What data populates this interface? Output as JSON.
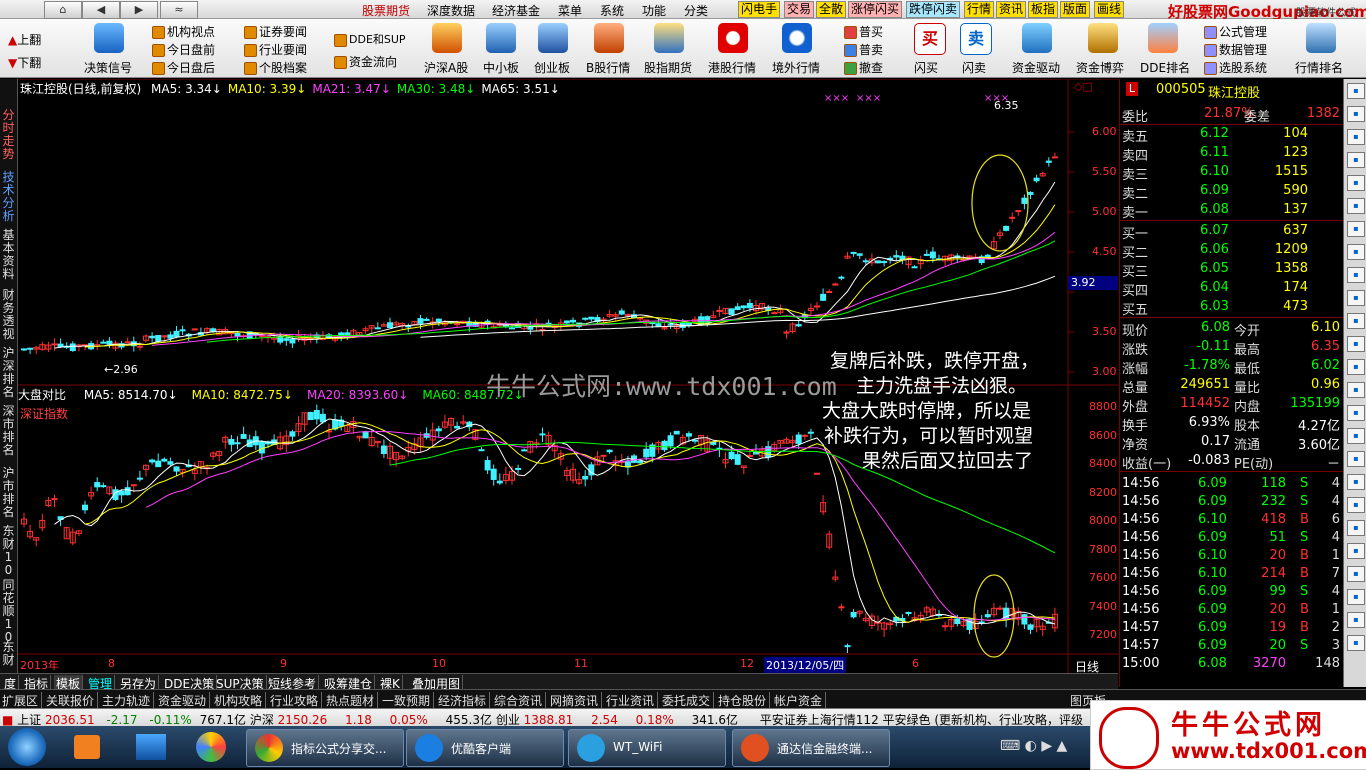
{
  "menubar": {
    "nav": [
      "⌂",
      "◀",
      "▶",
      "≈"
    ],
    "items": [
      "股票期货",
      "深度数据",
      "经济基金",
      "菜单",
      "系统",
      "功能",
      "分类"
    ],
    "tags": [
      "闪电手",
      "交易",
      "全散",
      "涨停闪买",
      "跌停闪卖",
      "行情",
      "资讯",
      "板指",
      "版面",
      "画线"
    ],
    "brand": "好股票网Goodgupiao.com",
    "brand_sub": "股票软件公式"
  },
  "toolbar": {
    "left_buttons": [
      "上翻",
      "下翻"
    ],
    "decision_label": "决策信号",
    "group1": [
      "机构视点",
      "今日盘前",
      "今日盘后"
    ],
    "group2": [
      "证券要闻",
      "行业要闻",
      "个股档案"
    ],
    "group3": [
      "DDE和SUP",
      "资金流向"
    ],
    "icons": [
      "沪深A股",
      "中小板",
      "创业板",
      "B股行情",
      "股指期货",
      "港股行情",
      "境外行情"
    ],
    "trade_list": [
      "普买",
      "普卖",
      "撤查"
    ],
    "icons2": [
      "闪买",
      "闪卖",
      "资金驱动",
      "资金博弈",
      "DDE排名"
    ],
    "group4": [
      "公式管理",
      "数据管理",
      "选股系统"
    ],
    "last": "行情排名"
  },
  "lefttabs": [
    "分时走势",
    "技术分析",
    "基本资料",
    "财务透视",
    "沪深排名",
    "深市排名",
    "沪市排名",
    "东财10",
    "同花顺10",
    "东财"
  ],
  "chart": {
    "upper_header": {
      "name": "珠江控股(日线,前复权)",
      "ma": [
        {
          "label": "MA5: 3.34",
          "color": "#ffffff"
        },
        {
          "label": "MA10: 3.39",
          "color": "#ffff00"
        },
        {
          "label": "MA21: 3.47",
          "color": "#ff40ff"
        },
        {
          "label": "MA30: 3.48",
          "color": "#00ff00"
        },
        {
          "label": "MA65: 3.51",
          "color": "#ffffff"
        }
      ],
      "high_label": "6.35",
      "low_label": "2.96",
      "current_price": "3.92",
      "yaxis": [
        "6.00",
        "5.50",
        "5.00",
        "4.50",
        "3.50",
        "3.00"
      ]
    },
    "lower_header": {
      "name": "大盘对比",
      "index_name": "深证指数",
      "ma": [
        {
          "label": "MA5: 8514.70",
          "color": "#ffffff"
        },
        {
          "label": "MA10: 8472.75",
          "color": "#ffff00"
        },
        {
          "label": "MA20: 8393.60",
          "color": "#ff40ff"
        },
        {
          "label": "MA60: 8487.72",
          "color": "#00ff00"
        }
      ],
      "yaxis": [
        "8800",
        "8600",
        "8400",
        "8200",
        "8000",
        "7800",
        "7600",
        "7400",
        "7200"
      ]
    },
    "xaxis": [
      "2013年",
      "8",
      "9",
      "10",
      "11",
      "12",
      "2013/12/05/四",
      "6"
    ],
    "period": "日线",
    "watermark": "牛牛公式网:www.tdx001.com",
    "annotation": [
      "复牌后补跌，跌停开盘，",
      "主力洗盘手法凶狠。",
      "大盘大跌时停牌，所以是",
      "补跌行为，可以暂时观望",
      "果然后面又拉回去了"
    ],
    "markers_x": [
      "×××",
      "×××",
      "×××"
    ]
  },
  "panel": {
    "code": "000505",
    "name": "珠江控股",
    "weibi_label": "委比",
    "weibi": "21.87%",
    "weicha_label": "委差",
    "weicha": "1382",
    "sells": [
      {
        "label": "卖五",
        "price": "6.12",
        "vol": "104"
      },
      {
        "label": "卖四",
        "price": "6.11",
        "vol": "123"
      },
      {
        "label": "卖三",
        "price": "6.10",
        "vol": "1515"
      },
      {
        "label": "卖二",
        "price": "6.09",
        "vol": "590"
      },
      {
        "label": "卖一",
        "price": "6.08",
        "vol": "137"
      }
    ],
    "buys": [
      {
        "label": "买一",
        "price": "6.07",
        "vol": "637"
      },
      {
        "label": "买二",
        "price": "6.06",
        "vol": "1209"
      },
      {
        "label": "买三",
        "price": "6.05",
        "vol": "1358"
      },
      {
        "label": "买四",
        "price": "6.04",
        "vol": "174"
      },
      {
        "label": "买五",
        "price": "6.03",
        "vol": "473"
      }
    ],
    "stats": [
      {
        "l1": "现价",
        "v1": "6.08",
        "c1": "#00ff00",
        "l2": "今开",
        "v2": "6.10",
        "c2": "#ffff00"
      },
      {
        "l1": "涨跌",
        "v1": "-0.11",
        "c1": "#00ff00",
        "l2": "最高",
        "v2": "6.35",
        "c2": "#ff3030"
      },
      {
        "l1": "涨幅",
        "v1": "-1.78%",
        "c1": "#00ff00",
        "l2": "最低",
        "v2": "6.02",
        "c2": "#00ff00"
      },
      {
        "l1": "总量",
        "v1": "249651",
        "c1": "#ffff00",
        "l2": "量比",
        "v2": "0.96",
        "c2": "#ffff00"
      },
      {
        "l1": "外盘",
        "v1": "114452",
        "c1": "#ff3030",
        "l2": "内盘",
        "v2": "135199",
        "c2": "#00ff00"
      },
      {
        "l1": "换手",
        "v1": "6.93%",
        "c1": "#ffffff",
        "l2": "股本",
        "v2": "4.27亿",
        "c2": "#ffffff"
      },
      {
        "l1": "净资",
        "v1": "0.17",
        "c1": "#ffffff",
        "l2": "流通",
        "v2": "3.60亿",
        "c2": "#ffffff"
      },
      {
        "l1": "收益(一)",
        "v1": "-0.083",
        "c1": "#ffffff",
        "l2": "PE(动)",
        "v2": "－",
        "c2": "#ffffff"
      }
    ],
    "ticks": [
      {
        "t": "14:56",
        "p": "6.09",
        "v": "118",
        "d": "S",
        "n": "4"
      },
      {
        "t": "14:56",
        "p": "6.09",
        "v": "232",
        "d": "S",
        "n": "4"
      },
      {
        "t": "14:56",
        "p": "6.10",
        "v": "418",
        "d": "B",
        "n": "6"
      },
      {
        "t": "14:56",
        "p": "6.09",
        "v": "51",
        "d": "S",
        "n": "4"
      },
      {
        "t": "14:56",
        "p": "6.10",
        "v": "20",
        "d": "B",
        "n": "1"
      },
      {
        "t": "14:56",
        "p": "6.10",
        "v": "214",
        "d": "B",
        "n": "7"
      },
      {
        "t": "14:56",
        "p": "6.09",
        "v": "99",
        "d": "S",
        "n": "4"
      },
      {
        "t": "14:56",
        "p": "6.09",
        "v": "20",
        "d": "B",
        "n": "1"
      },
      {
        "t": "14:57",
        "p": "6.09",
        "v": "19",
        "d": "B",
        "n": "2"
      },
      {
        "t": "14:57",
        "p": "6.09",
        "v": "20",
        "d": "S",
        "n": "3"
      },
      {
        "t": "15:00",
        "p": "6.08",
        "v": "3270",
        "d": "",
        "n": "148"
      }
    ]
  },
  "bottomtabs": [
    "度",
    "指标",
    "模板",
    "管理",
    "另存为",
    "DDE决策",
    "SUP决策",
    "短线参考",
    "吸筹建仓",
    "裸K",
    "叠加用图"
  ],
  "extbar": [
    "扩展区",
    "关联报价",
    "主力轨迹",
    "资金驱动",
    "机构攻略",
    "行业攻略",
    "热点题材",
    "一致预期",
    "经济指标",
    "综合资讯",
    "网摘资讯",
    "行业资讯",
    "委托成交",
    "持仓股份",
    "帐户资金"
  ],
  "extbar_right": "图页板",
  "statusbar": {
    "sh_label": "上证",
    "sh_val": "2036.51",
    "sh_chg": "-2.17",
    "sh_pct": "-0.11%",
    "sh_amt": "767.1亿",
    "hs_label": "沪深",
    "hs_val": "2150.26",
    "hs_chg": "1.18",
    "hs_pct": "0.05%",
    "hs_amt": "455.3亿",
    "cy_label": "创业",
    "cy_val": "1388.81",
    "cy_chg": "2.54",
    "cy_pct": "0.18%",
    "cy_amt": "341.6亿",
    "broker": "平安证券上海行情112",
    "news": "平安绿色 (更新机构、行业攻略，评级"
  },
  "taskbar": {
    "apps": [
      "指标公式分享交...",
      "优酷客户端",
      "WT_WiFi",
      "通达信金融终端..."
    ],
    "logo_title": "牛牛公式网",
    "logo_url": "www.tdx001.com"
  }
}
